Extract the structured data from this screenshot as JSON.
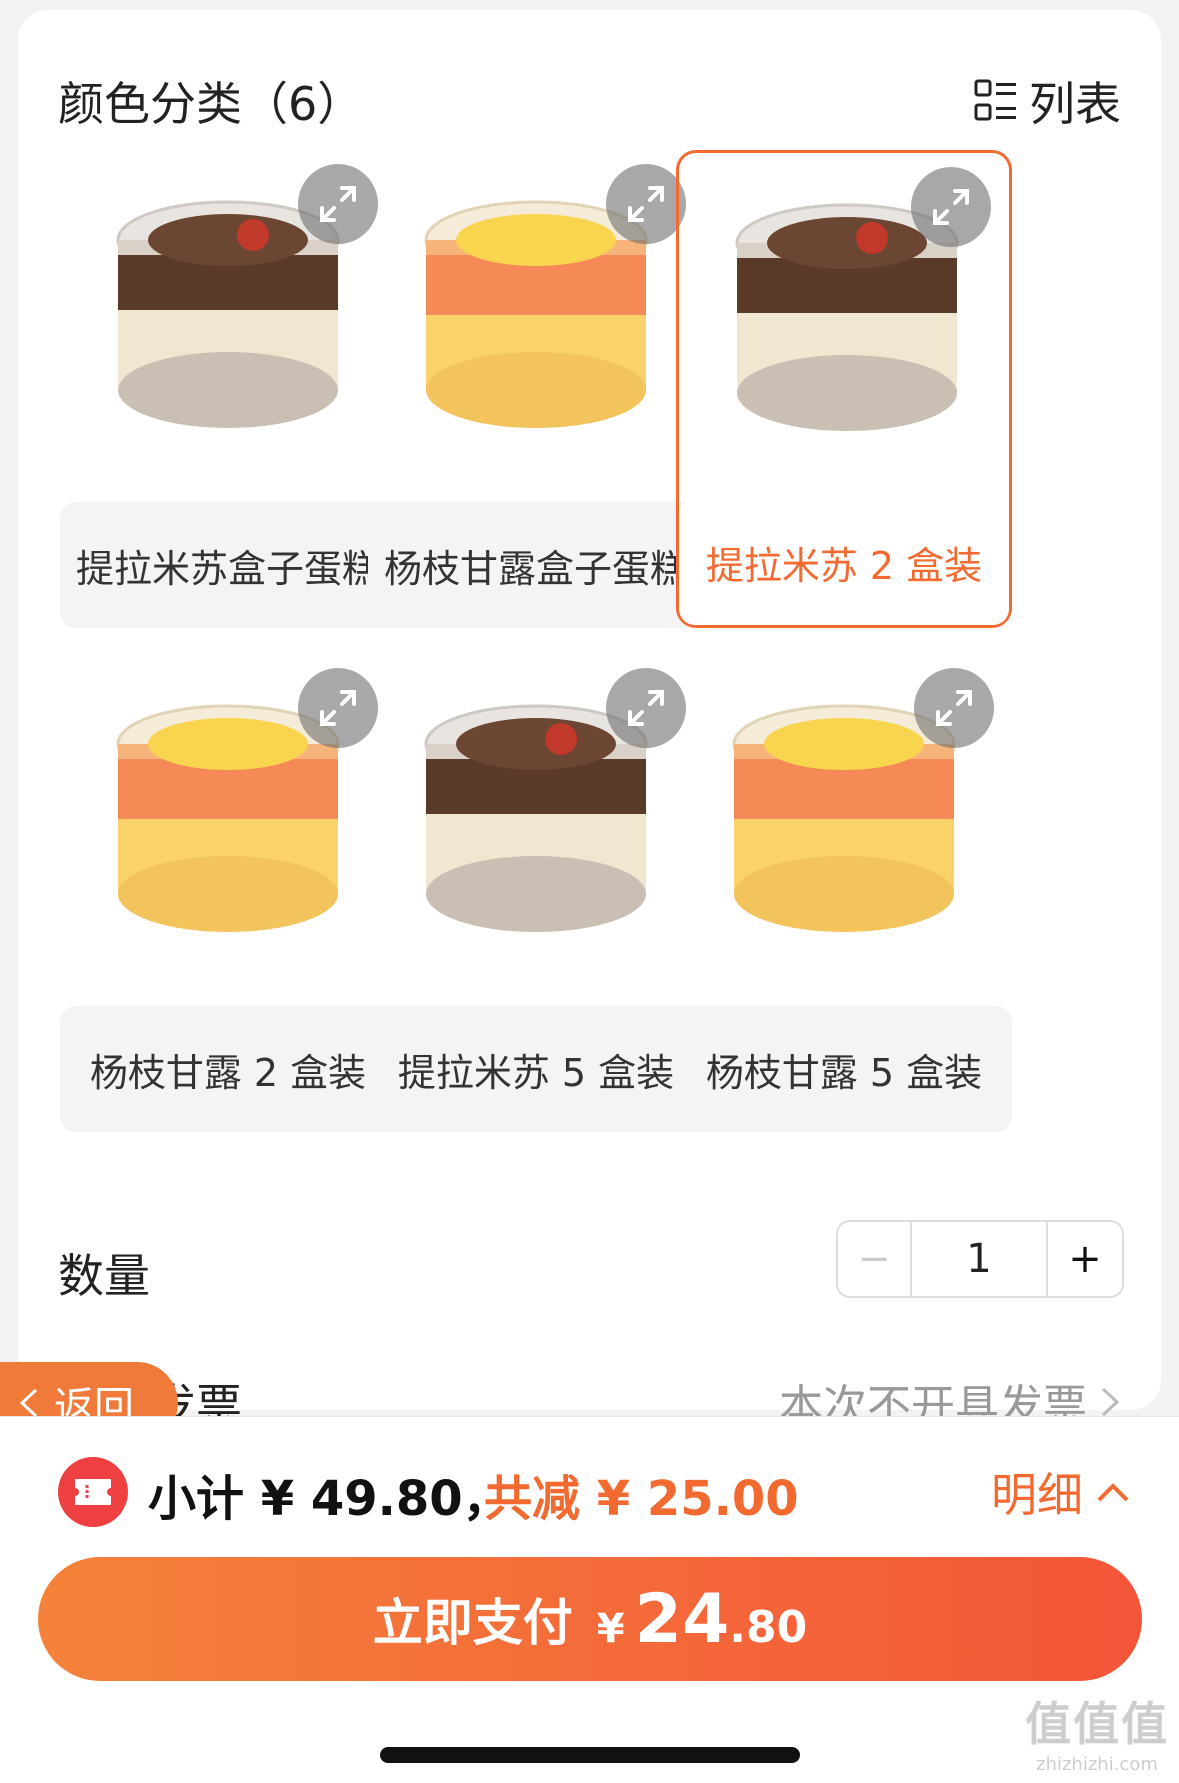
{
  "header": {
    "title": "颜色分类（6）",
    "view_toggle_label": "列表"
  },
  "products": [
    {
      "label": "提拉米苏盒子蛋糕",
      "flavor": "tiramisu",
      "selected": false
    },
    {
      "label": "杨枝甘露盒子蛋糕",
      "flavor": "mango",
      "selected": false
    },
    {
      "label": "提拉米苏 2 盒装",
      "flavor": "tiramisu",
      "selected": true
    },
    {
      "label": "杨枝甘露 2 盒装",
      "flavor": "mango",
      "selected": false
    },
    {
      "label": "提拉米苏 5 盒装",
      "flavor": "tiramisu",
      "selected": false
    },
    {
      "label": "杨枝甘露 5 盒装",
      "flavor": "mango",
      "selected": false
    }
  ],
  "quantity": {
    "label": "数量",
    "minus": "−",
    "value": "1",
    "plus": "+"
  },
  "invoice": {
    "label": "开具发票",
    "value": "本次不开具发票"
  },
  "back_button": {
    "label": "返回"
  },
  "summary": {
    "subtotal": "小计 ¥ 49.80，",
    "discount": "共减 ¥ 25.00",
    "detail": "明细"
  },
  "pay_button": {
    "label": "立即支付",
    "currency": "¥",
    "amount_int": "24",
    "amount_dec": ".80"
  },
  "watermark": {
    "big": "值值值",
    "small": "zhizhizhi.com"
  },
  "colors": {
    "accent": "#f26a30",
    "pay_gradient_start": "#f5823a",
    "pay_gradient_end": "#f35538",
    "coupon_red": "#ee4040"
  }
}
